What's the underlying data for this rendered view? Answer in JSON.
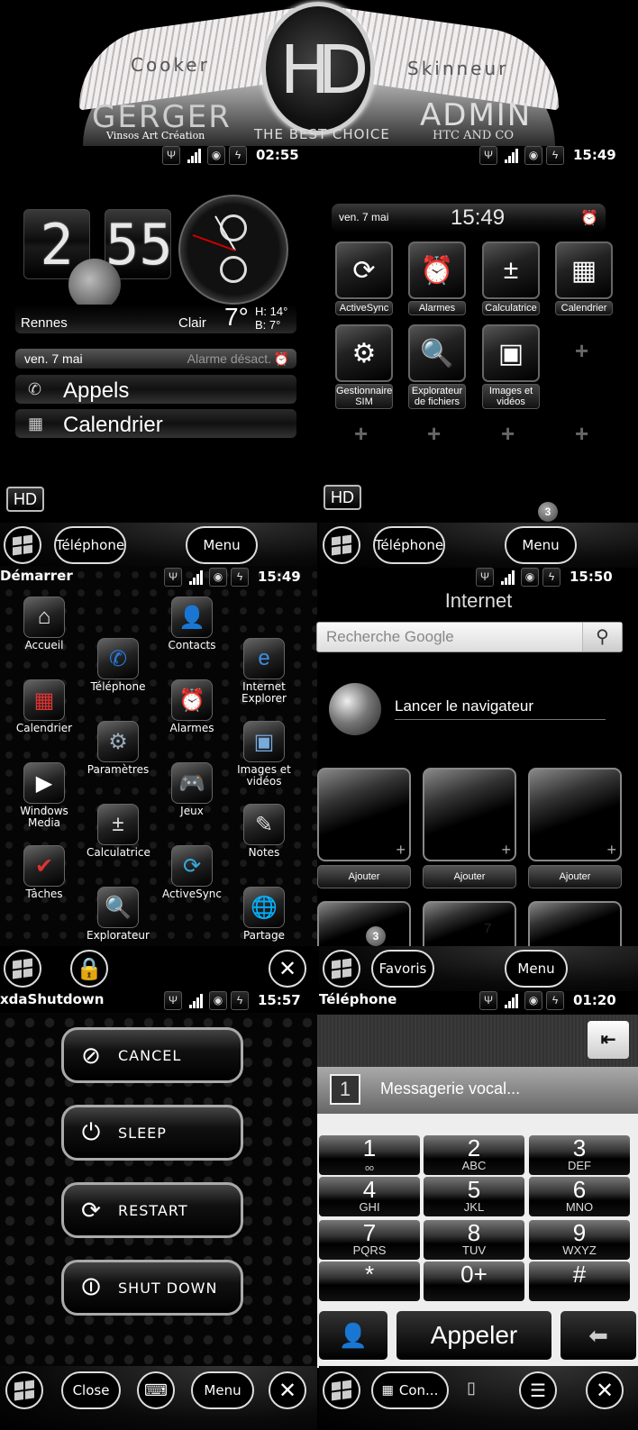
{
  "banner": {
    "emblem": "HD",
    "left_top": "Cooker",
    "right_top": "Skinneur",
    "left_name": "GERGER",
    "left_sub": "Vinsos Art Création",
    "center": "THE BEST CHOICE",
    "right_name": "ADMIN",
    "right_sub": "HTC AND CO"
  },
  "status_icons": [
    "usb-icon",
    "signal-icon",
    "sound-icon",
    "battery-charging-icon"
  ],
  "home1": {
    "status_time": "02:55",
    "clock_hour": "2",
    "clock_minute": "55",
    "city": "Rennes",
    "condition": "Clair",
    "temperature": "7°",
    "high": "H: 14°",
    "low": "B:   7°",
    "date": "ven. 7 mai",
    "alarm": "Alarme désact.",
    "rows": [
      {
        "icon": "missed-call-icon",
        "label": "Appels"
      },
      {
        "icon": "calendar-icon",
        "label": "Calendrier"
      }
    ],
    "hd_badge": "HD"
  },
  "home2": {
    "status_time": "15:49",
    "date": "ven. 7 mai",
    "time": "15:49",
    "tiles": [
      {
        "label": "ActiveSync",
        "glyph": "⟳"
      },
      {
        "label": "Alarmes",
        "glyph": "⏰"
      },
      {
        "label": "Calculatrice",
        "glyph": "±"
      },
      {
        "label": "Calendrier",
        "glyph": "▦"
      },
      {
        "label": "Gestionnaire SIM",
        "glyph": "⚙"
      },
      {
        "label": "Explorateur de fichiers",
        "glyph": "🔍"
      },
      {
        "label": "Images et vidéos",
        "glyph": "▣"
      }
    ],
    "hd_badge": "HD",
    "page_badge": "3"
  },
  "taskbar1": {
    "left": "Téléphone",
    "right": "Menu"
  },
  "taskbar2": {
    "left": "Téléphone",
    "right": "Menu"
  },
  "start": {
    "title": "Démarrer",
    "status_time": "15:49",
    "apps": [
      {
        "label": "Accueil",
        "glyph": "⌂",
        "color": "#eee"
      },
      {
        "label": "Contacts",
        "glyph": "👤",
        "color": "#f07a1a"
      },
      {
        "label": "Téléphone",
        "glyph": "✆",
        "color": "#2a7ae0"
      },
      {
        "label": "Internet Explorer",
        "glyph": "e",
        "color": "#3a8ee8"
      },
      {
        "label": "Calendrier",
        "glyph": "▦",
        "color": "#d33"
      },
      {
        "label": "Alarmes",
        "glyph": "⏰",
        "color": "#c22"
      },
      {
        "label": "Paramètres",
        "glyph": "⚙",
        "color": "#9ab"
      },
      {
        "label": "Images et vidéos",
        "glyph": "▣",
        "color": "#7ad"
      },
      {
        "label": "Windows Media",
        "glyph": "▶",
        "color": "#fff"
      },
      {
        "label": "Jeux",
        "glyph": "🎮",
        "color": "#eee"
      },
      {
        "label": "Calculatrice",
        "glyph": "±",
        "color": "#ddd"
      },
      {
        "label": "Notes",
        "glyph": "✎",
        "color": "#ddd"
      },
      {
        "label": "Tâches",
        "glyph": "✔",
        "color": "#d33"
      },
      {
        "label": "ActiveSync",
        "glyph": "⟳",
        "color": "#3ad"
      },
      {
        "label": "Explorateur",
        "glyph": "🔍",
        "color": "#eb3"
      },
      {
        "label": "Partage",
        "glyph": "🌐",
        "color": "#38e"
      }
    ]
  },
  "internet": {
    "status_time": "15:50",
    "title": "Internet",
    "search_placeholder": "Recherche Google",
    "launch": "Lancer le navigateur",
    "favorites": [
      "Ajouter",
      "Ajouter",
      "Ajouter"
    ],
    "page_badge": "3",
    "extra_count": "7"
  },
  "taskbar3": {},
  "taskbar4": {
    "left": "Favoris",
    "right": "Menu"
  },
  "shutdown": {
    "title": "xdaShutdown",
    "status_time": "15:57",
    "buttons": [
      {
        "label": "CANCEL",
        "glyph": "⊘"
      },
      {
        "label": "SLEEP",
        "glyph": "⏻"
      },
      {
        "label": "RESTART",
        "glyph": "⟳"
      },
      {
        "label": "SHUT DOWN",
        "glyph": "⏼"
      }
    ]
  },
  "taskbar5": {
    "left": "Close",
    "right": "Menu"
  },
  "dialer": {
    "title": "Téléphone",
    "status_time": "01:20",
    "voicemail_key": "1",
    "voicemail": "Messagerie vocal...",
    "keys": [
      {
        "n": "1",
        "l": "ₒₒ"
      },
      {
        "n": "2",
        "l": "ABC"
      },
      {
        "n": "3",
        "l": "DEF"
      },
      {
        "n": "4",
        "l": "GHI"
      },
      {
        "n": "5",
        "l": "JKL"
      },
      {
        "n": "6",
        "l": "MNO"
      },
      {
        "n": "7",
        "l": "PQRS"
      },
      {
        "n": "8",
        "l": "TUV"
      },
      {
        "n": "9",
        "l": "WXYZ"
      },
      {
        "n": "*",
        "l": ""
      },
      {
        "n": "0+",
        "l": ""
      },
      {
        "n": "#",
        "l": ""
      }
    ],
    "call": "Appeler"
  },
  "taskbar6": {
    "left": "Con..."
  }
}
